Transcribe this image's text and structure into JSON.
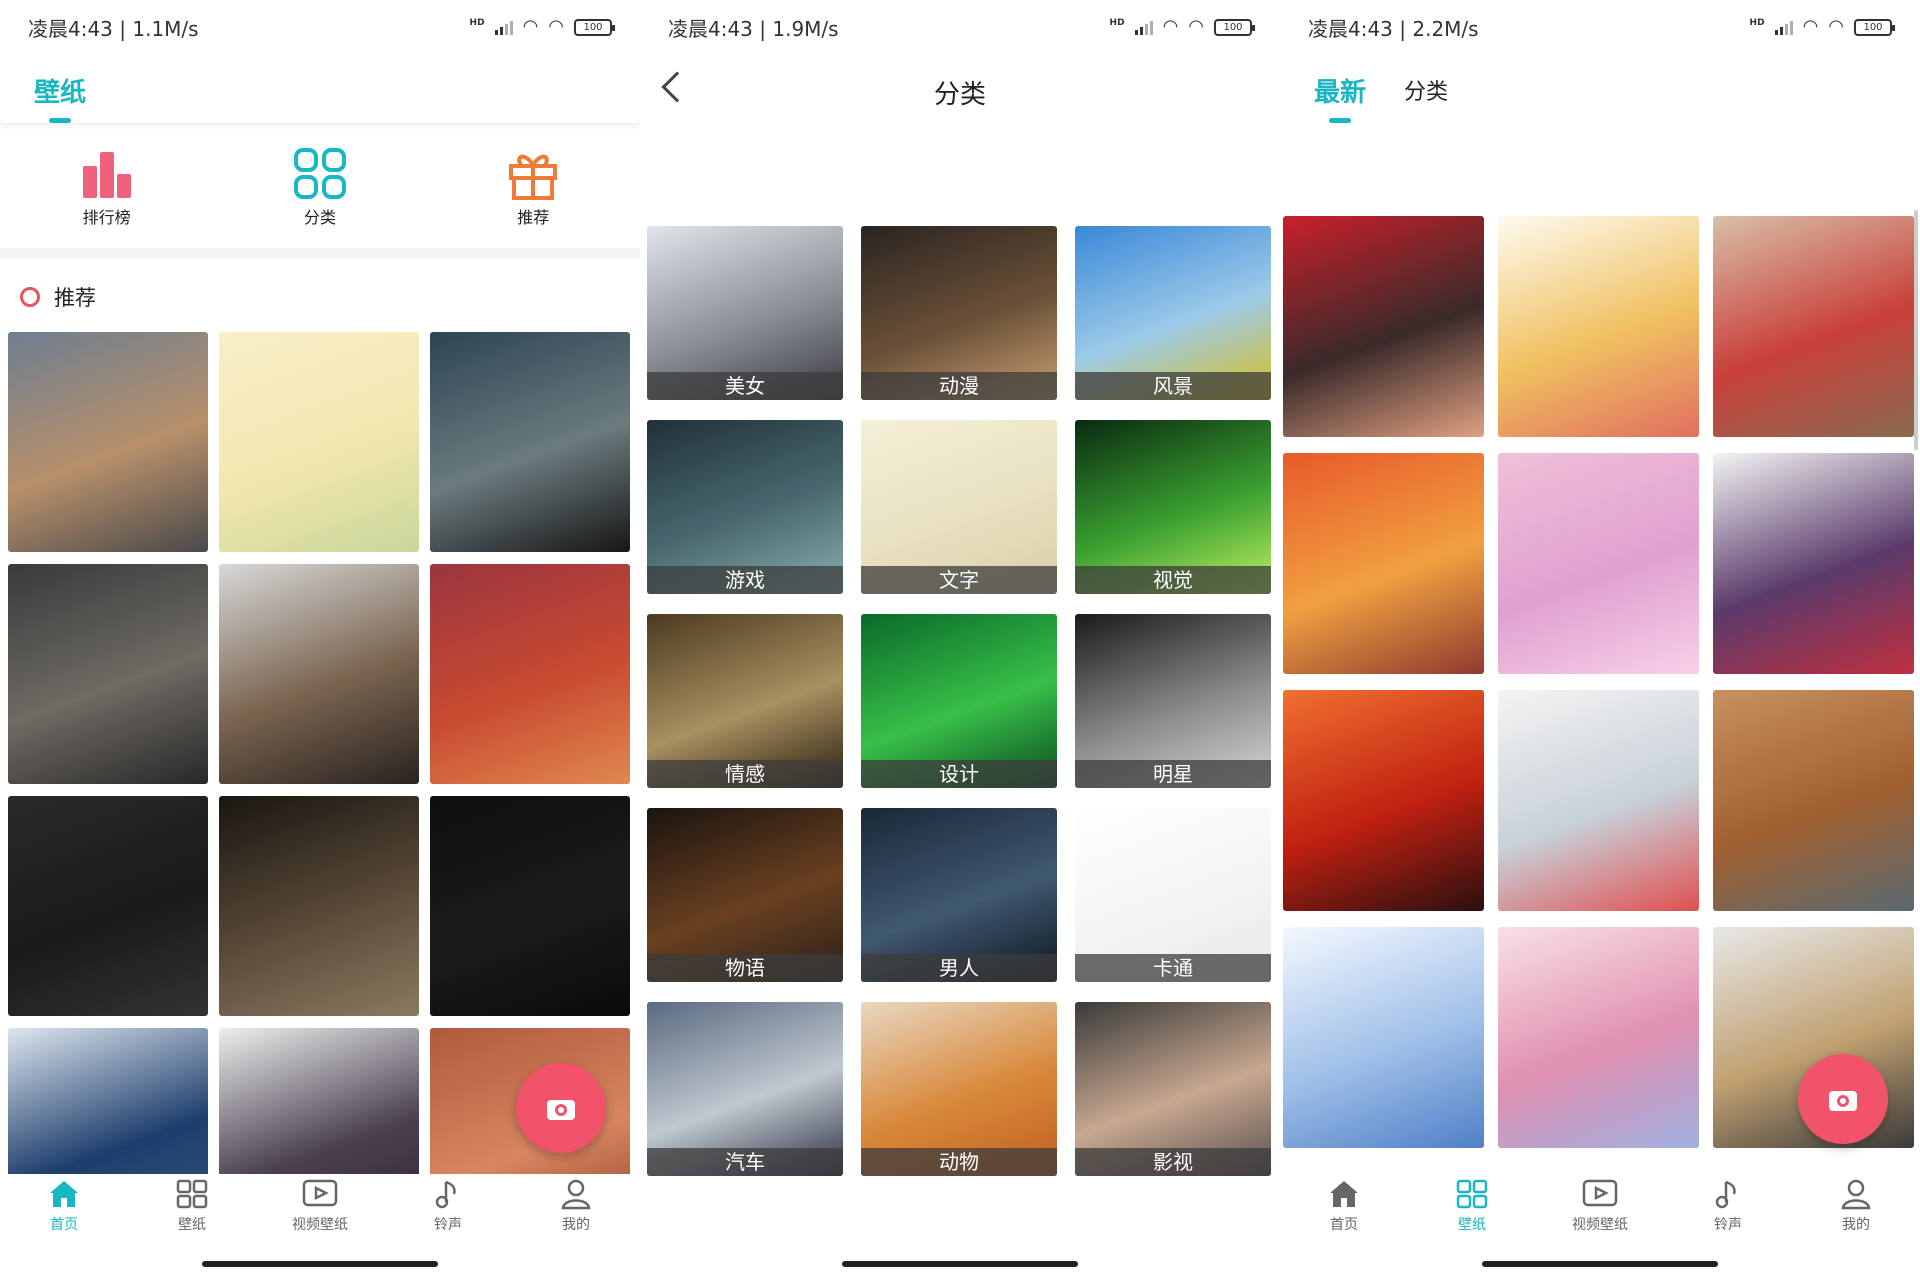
{
  "screen1": {
    "status": {
      "text": "凌晨4:43 | 1.1M/s",
      "battery": "100"
    },
    "header": {
      "tab": "壁纸"
    },
    "quick": [
      {
        "label": "排行榜",
        "icon": "ranking-icon",
        "color": "#f0617a"
      },
      {
        "label": "分类",
        "icon": "grid-icon",
        "color": "#19b6c4"
      },
      {
        "label": "推荐",
        "icon": "gift-icon",
        "color": "#f07a3a"
      }
    ],
    "section_title": "推荐",
    "wallpapers": [
      {
        "name": "mountain-road",
        "colors": [
          "#6e7f90",
          "#b7906a",
          "#4a4a4a"
        ]
      },
      {
        "name": "pastel-illustration",
        "colors": [
          "#f8efc8",
          "#f3e6b0",
          "#c8d79a"
        ]
      },
      {
        "name": "sunset-fire",
        "colors": [
          "#2c4454",
          "#6b7b7e",
          "#171616"
        ]
      },
      {
        "name": "tifa-character",
        "colors": [
          "#3a3a3a",
          "#6e6a64",
          "#2a2828"
        ]
      },
      {
        "name": "bald-eagle",
        "colors": [
          "#d8d8d8",
          "#7a6450",
          "#2a2320"
        ]
      },
      {
        "name": "asuka-anime",
        "colors": [
          "#9b3540",
          "#c84a30",
          "#e08850"
        ]
      },
      {
        "name": "car-dashboard",
        "colors": [
          "#2a2a2a",
          "#1a1a1a",
          "#333333"
        ]
      },
      {
        "name": "light-heart",
        "colors": [
          "#1a1612",
          "#5a4a38",
          "#8a7a62"
        ]
      },
      {
        "name": "black-typography",
        "colors": [
          "#0e0e0e",
          "#1b1b1b",
          "#0a0a0a"
        ]
      },
      {
        "name": "model-blue-dress",
        "colors": [
          "#dde6ee",
          "#1d3d6c",
          "#3a5a82"
        ]
      },
      {
        "name": "anime-girl-black",
        "colors": [
          "#eeeeee",
          "#4a4050",
          "#2a2230"
        ]
      },
      {
        "name": "warm-portrait",
        "colors": [
          "#b05a3c",
          "#d88660",
          "#803a24"
        ]
      }
    ],
    "tabbar": [
      {
        "label": "首页",
        "icon": "home-icon",
        "active": true
      },
      {
        "label": "壁纸",
        "icon": "grid-icon",
        "active": false
      },
      {
        "label": "视频壁纸",
        "icon": "video-icon",
        "active": false
      },
      {
        "label": "铃声",
        "icon": "music-note-icon",
        "active": false
      },
      {
        "label": "我的",
        "icon": "profile-icon",
        "active": false
      }
    ]
  },
  "screen2": {
    "status": {
      "text": "凌晨4:43 | 1.9M/s",
      "battery": "100"
    },
    "title": "分类",
    "categories": [
      {
        "label": "美女",
        "colors": [
          "#dfe5ea",
          "#8a8f96",
          "#3a3a40"
        ]
      },
      {
        "label": "动漫",
        "colors": [
          "#2a2420",
          "#6a5038",
          "#c8a070"
        ]
      },
      {
        "label": "风景",
        "colors": [
          "#3a88d8",
          "#9ccae8",
          "#d8c020"
        ]
      },
      {
        "label": "游戏",
        "colors": [
          "#20303a",
          "#4a6a70",
          "#8ab0b0"
        ]
      },
      {
        "label": "文字",
        "colors": [
          "#f4efd8",
          "#e8e0c0",
          "#d8cfa8"
        ]
      },
      {
        "label": "视觉",
        "colors": [
          "#0a2a10",
          "#3aa030",
          "#c0f060"
        ]
      },
      {
        "label": "情感",
        "colors": [
          "#4a3a20",
          "#a89060",
          "#2a2010"
        ]
      },
      {
        "label": "设计",
        "colors": [
          "#0a6a2a",
          "#38c048",
          "#0a4a20"
        ]
      },
      {
        "label": "明星",
        "colors": [
          "#1a1a1a",
          "#8a8a8a",
          "#d8d8d8"
        ]
      },
      {
        "label": "物语",
        "colors": [
          "#1a1410",
          "#6a4020",
          "#2a2018"
        ]
      },
      {
        "label": "男人",
        "colors": [
          "#1a2838",
          "#405870",
          "#0e1620"
        ]
      },
      {
        "label": "卡通",
        "colors": [
          "#ffffff",
          "#f4f4f4",
          "#e8e8e8"
        ]
      },
      {
        "label": "汽车",
        "colors": [
          "#5a6a80",
          "#c0c8d0",
          "#2a3040"
        ]
      },
      {
        "label": "动物",
        "colors": [
          "#e8d8c0",
          "#d8883a",
          "#c06020"
        ]
      },
      {
        "label": "影视",
        "colors": [
          "#3a3a3a",
          "#c8a890",
          "#5a5050"
        ]
      }
    ]
  },
  "screen3": {
    "status": {
      "text": "凌晨4:43 | 2.2M/s",
      "battery": "100"
    },
    "tabs": [
      {
        "label": "最新",
        "active": true
      },
      {
        "label": "分类",
        "active": false
      }
    ],
    "wallpapers": [
      {
        "name": "painted-woman-red",
        "colors": [
          "#c8202a",
          "#3a2a2a",
          "#e0a080"
        ]
      },
      {
        "name": "lots-of-snacks",
        "colors": [
          "#fdfbf0",
          "#f0c060",
          "#e07060"
        ]
      },
      {
        "name": "vintage-room",
        "colors": [
          "#d8c0a8",
          "#c8403a",
          "#8a6a50"
        ]
      },
      {
        "name": "orange-sunset",
        "colors": [
          "#e85a2a",
          "#f0a040",
          "#903a30"
        ]
      },
      {
        "name": "pink-clouds",
        "colors": [
          "#f0c0d8",
          "#e0a0d0",
          "#f8d0e8"
        ]
      },
      {
        "name": "anime-kimono",
        "colors": [
          "#f4f4f4",
          "#5a3a6a",
          "#c03040"
        ]
      },
      {
        "name": "fireplace",
        "colors": [
          "#f07030",
          "#c02010",
          "#2a1010"
        ]
      },
      {
        "name": "kashima-anime",
        "colors": [
          "#f4f4f4",
          "#c8d0d8",
          "#e05050"
        ]
      },
      {
        "name": "coastline",
        "colors": [
          "#c89060",
          "#a06030",
          "#5a6a70"
        ]
      },
      {
        "name": "sailor-mercury",
        "colors": [
          "#f4f8ff",
          "#a0c0e8",
          "#5080c8"
        ]
      },
      {
        "name": "anime-schoolgirl",
        "colors": [
          "#f8e0e8",
          "#e090b0",
          "#a0b0e0"
        ]
      },
      {
        "name": "figure-model",
        "colors": [
          "#e8e8e8",
          "#c0a070",
          "#3a3a3a"
        ]
      }
    ],
    "tabbar": [
      {
        "label": "首页",
        "icon": "home-icon",
        "active": false
      },
      {
        "label": "壁纸",
        "icon": "grid-icon",
        "active": true
      },
      {
        "label": "视频壁纸",
        "icon": "video-icon",
        "active": false
      },
      {
        "label": "铃声",
        "icon": "music-note-icon",
        "active": false
      },
      {
        "label": "我的",
        "icon": "profile-icon",
        "active": false
      }
    ]
  },
  "colors": {
    "accent": "#19b6c4",
    "fab": "#f0536a"
  }
}
